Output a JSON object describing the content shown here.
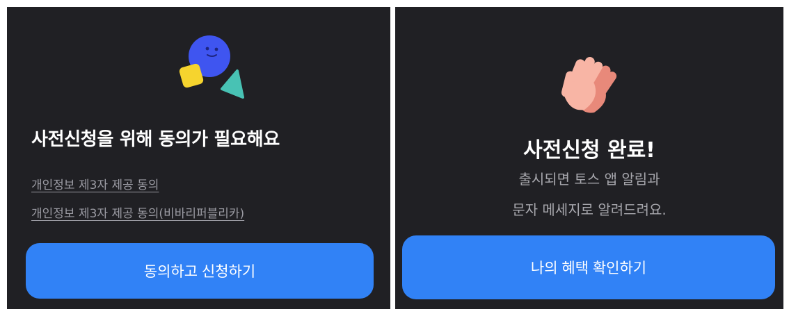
{
  "left_screen": {
    "heading": "사전신청을 위해 동의가 필요해요",
    "consent_links": [
      "개인정보 제3자 제공 동의",
      "개인정보 제3자 제공 동의(비바리퍼블리카)"
    ],
    "button_label": "동의하고 신청하기",
    "illustration_icon": "blue-face-with-yellow-square-and-teal-triangle-icon"
  },
  "right_screen": {
    "heading": "사전신청 완료!",
    "message_lines": [
      "출시되면 토스 앱 알림과",
      "문자 메세지로 알려드려요."
    ],
    "button_label": "나의 혜택 확인하기",
    "illustration_icon": "clapping-hands-icon"
  },
  "colors": {
    "background": "#202024",
    "primary_button": "#3182f6",
    "link_text": "#9b9ba3",
    "sub_text": "#a7a7ad",
    "heading_text": "#ffffff"
  }
}
